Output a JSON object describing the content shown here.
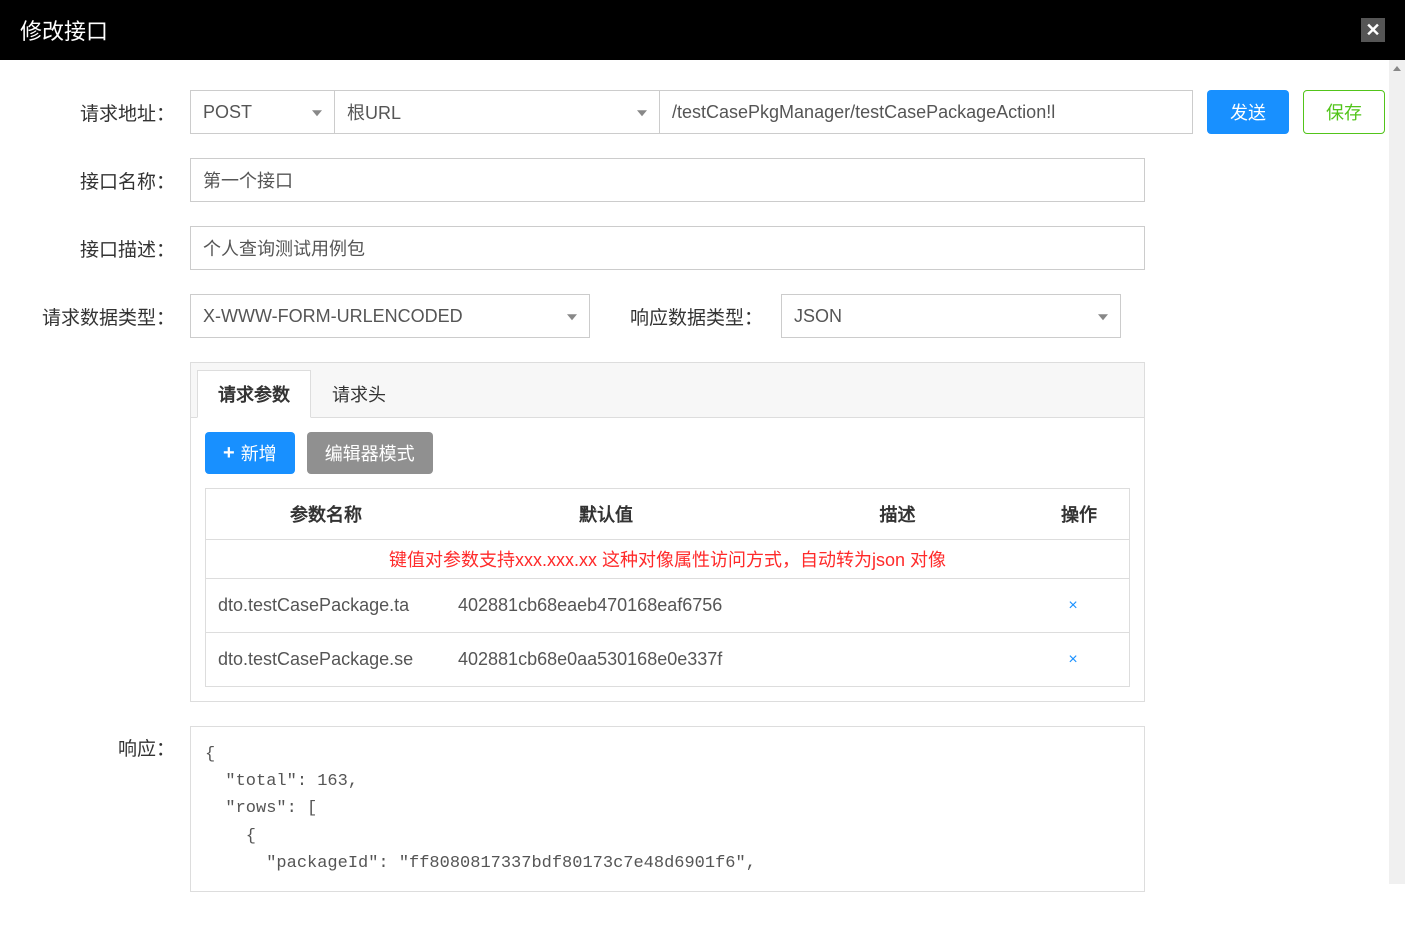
{
  "modal": {
    "title": "修改接口"
  },
  "labels": {
    "requestUrl": "请求地址：",
    "interfaceName": "接口名称：",
    "interfaceDesc": "接口描述：",
    "requestDataType": "请求数据类型：",
    "responseDataType": "响应数据类型：",
    "response": "响应："
  },
  "form": {
    "method": "POST",
    "urlBase": "根URL",
    "urlPath": "/testCasePkgManager/testCasePackageAction!l",
    "interfaceName": "第一个接口",
    "interfaceDesc": "个人查询测试用例包",
    "requestDataType": "X-WWW-FORM-URLENCODED",
    "responseDataType": "JSON"
  },
  "buttons": {
    "send": "发送",
    "save": "保存",
    "add": "新增",
    "editorMode": "编辑器模式"
  },
  "tabs": {
    "requestParams": "请求参数",
    "requestHeaders": "请求头"
  },
  "table": {
    "headers": {
      "paramName": "参数名称",
      "defaultValue": "默认值",
      "description": "描述",
      "operation": "操作"
    },
    "hint": "键值对参数支持xxx.xxx.xx 这种对像属性访问方式，自动转为json 对像",
    "rows": [
      {
        "paramName": "dto.testCasePackage.ta",
        "defaultValue": "402881cb68eaeb470168eaf6756",
        "description": ""
      },
      {
        "paramName": "dto.testCasePackage.se",
        "defaultValue": "402881cb68e0aa530168e0e337f",
        "description": ""
      }
    ]
  },
  "responseBody": "{\n  \"total\": 163,\n  \"rows\": [\n    {\n      \"packageId\": \"ff8080817337bdf80173c7e48d6901f6\","
}
